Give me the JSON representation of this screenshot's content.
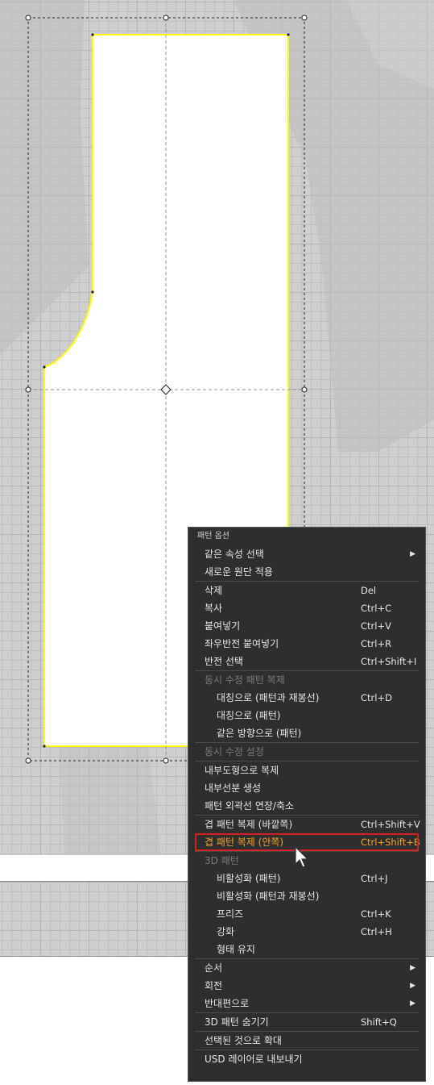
{
  "menu": {
    "title": "패턴 옵션",
    "items": [
      {
        "label": "같은 속성 선택",
        "shortcut": "",
        "arrow": "▶"
      },
      {
        "label": "새로운 원단 적용",
        "shortcut": ""
      },
      {
        "label": "삭제",
        "shortcut": "Del"
      },
      {
        "label": "복사",
        "shortcut": "Ctrl+C"
      },
      {
        "label": "붙여넣기",
        "shortcut": "Ctrl+V"
      },
      {
        "label": "좌우반전 붙여넣기",
        "shortcut": "Ctrl+R"
      },
      {
        "label": "반전 선택",
        "shortcut": "Ctrl+Shift+I"
      },
      {
        "label": "동시 수정 패턴 복제",
        "shortcut": ""
      },
      {
        "label": "대칭으로 (패턴과 재봉선)",
        "shortcut": "Ctrl+D"
      },
      {
        "label": "대칭으로 (패턴)",
        "shortcut": ""
      },
      {
        "label": "같은 방향으로 (패턴)",
        "shortcut": ""
      },
      {
        "label": "동시 수정 설정",
        "shortcut": ""
      },
      {
        "label": "내부도형으로 복제",
        "shortcut": ""
      },
      {
        "label": "내부선분 생성",
        "shortcut": ""
      },
      {
        "label": "패턴 외곽선 연장/축소",
        "shortcut": ""
      },
      {
        "label": "겹 패턴 복제 (바깥쪽)",
        "shortcut": "Ctrl+Shift+V"
      },
      {
        "label": "겹 패턴 복제 (안쪽)",
        "shortcut": "Ctrl+Shift+B"
      },
      {
        "label": "3D 패턴",
        "shortcut": ""
      },
      {
        "label": "비활성화 (패턴)",
        "shortcut": "Ctrl+J"
      },
      {
        "label": "비활성화 (패턴과 재봉선)",
        "shortcut": ""
      },
      {
        "label": "프리즈",
        "shortcut": "Ctrl+K"
      },
      {
        "label": "강화",
        "shortcut": "Ctrl+H"
      },
      {
        "label": "형태 유지",
        "shortcut": ""
      },
      {
        "label": "순서",
        "shortcut": "",
        "arrow": "▶"
      },
      {
        "label": "회전",
        "shortcut": "",
        "arrow": "▶"
      },
      {
        "label": "반대편으로",
        "shortcut": "",
        "arrow": "▶"
      },
      {
        "label": "3D 패턴 숨기기",
        "shortcut": "Shift+Q"
      },
      {
        "label": "선택된 것으로 확대",
        "shortcut": ""
      },
      {
        "label": "USD 레이어로 내보내기",
        "shortcut": ""
      }
    ]
  },
  "colors": {
    "menu_bg": "#2e2e2e",
    "highlight_text": "#f2a52a",
    "highlight_border": "#d61f1f",
    "pattern_outline": "#ffff00",
    "pattern_fill": "#ffffff"
  },
  "icons": {
    "cursor": "mouse-pointer-icon"
  }
}
